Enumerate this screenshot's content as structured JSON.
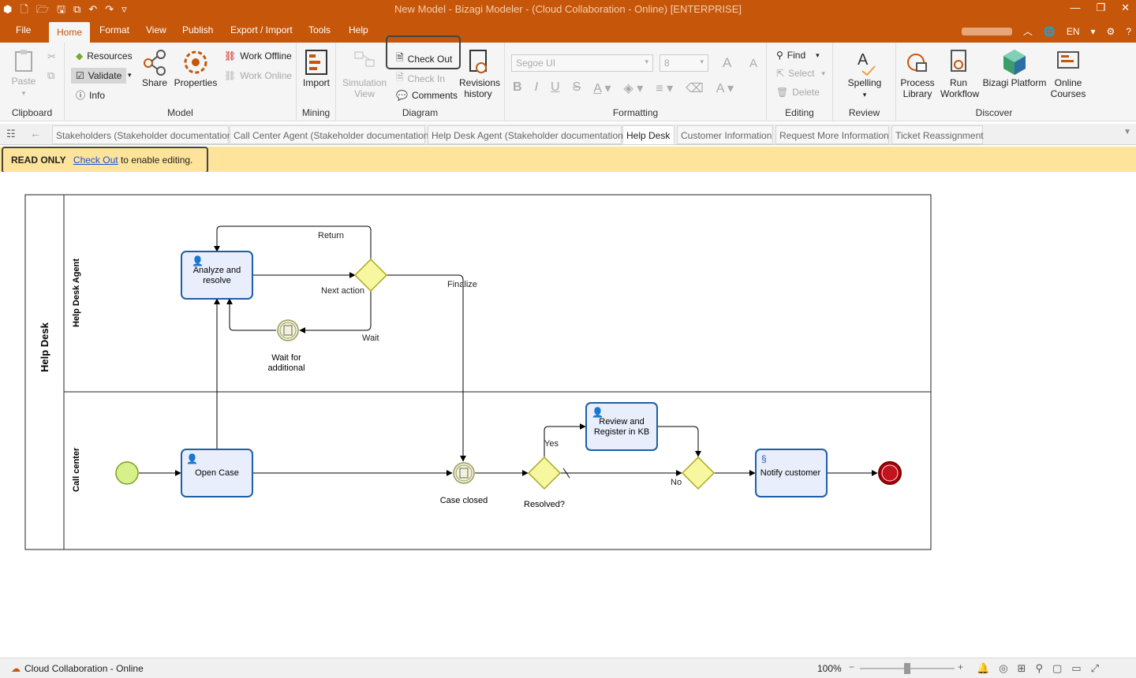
{
  "window": {
    "title": "New Model - Bizagi Modeler - (Cloud Collaboration - Online) [ENTERPRISE]"
  },
  "ribbon_tabs": [
    "File",
    "Home",
    "Format",
    "View",
    "Publish",
    "Export / Import",
    "Tools",
    "Help"
  ],
  "language": "EN",
  "clipboard": {
    "paste": "Paste",
    "label": "Clipboard"
  },
  "model": {
    "resources": "Resources",
    "validate": "Validate",
    "info": "Info",
    "share": "Share",
    "properties": "Properties",
    "work_offline": "Work Offline",
    "work_online": "Work Online",
    "label": "Model"
  },
  "mining": {
    "import": "Import",
    "label": "Mining"
  },
  "diagram": {
    "simulation": "Simulation",
    "simulation2": "View",
    "check_out": "Check Out",
    "check_in": "Check In",
    "comments": "Comments",
    "revisions": "Revisions",
    "revisions2": "history",
    "label": "Diagram"
  },
  "formatting": {
    "font": "Segoe UI",
    "size": "8",
    "label": "Formatting"
  },
  "editing": {
    "find": "Find",
    "select": "Select",
    "delete": "Delete",
    "label": "Editing"
  },
  "review": {
    "spelling": "Spelling",
    "label": "Review"
  },
  "discover": {
    "process": "Process",
    "library": "Library",
    "run": "Run",
    "workflow": "Workflow",
    "platform": "Bizagi Platform",
    "online": "Online",
    "courses": "Courses",
    "label": "Discover"
  },
  "doc_tabs": [
    "Stakeholders (Stakeholder documentation)",
    "Call Center Agent (Stakeholder documentation)",
    "Help Desk Agent (Stakeholder documentation)",
    "Help Desk",
    "Customer Information",
    "Request More Information",
    "Ticket Reassignment"
  ],
  "readonly": {
    "label": "READ ONLY",
    "link": "Check Out",
    "rest": "to enable editing."
  },
  "diagram_content": {
    "pool": "Help Desk",
    "lane1": "Help Desk Agent",
    "lane2": "Call center",
    "task_analyze": [
      "Analyze and",
      "resolve"
    ],
    "task_open": "Open Case",
    "task_review": [
      "Review and",
      "Register in KB"
    ],
    "task_notify": "Notify customer",
    "event_wait": [
      "Wait for",
      "additional"
    ],
    "event_closed": "Case closed",
    "gw_resolved": "Resolved?",
    "flow_return": "Return",
    "flow_next": "Next action",
    "flow_finalize": "Finalize",
    "flow_wait": "Wait",
    "flow_yes": "Yes",
    "flow_no": "No"
  },
  "status": {
    "mode": "Cloud Collaboration - Online",
    "zoom": "100%"
  },
  "colors": {
    "accent": "#c5560a",
    "task_fill": "#e8eefb",
    "task_stroke": "#1f5fa6",
    "gateway": "#f7f7a0"
  }
}
